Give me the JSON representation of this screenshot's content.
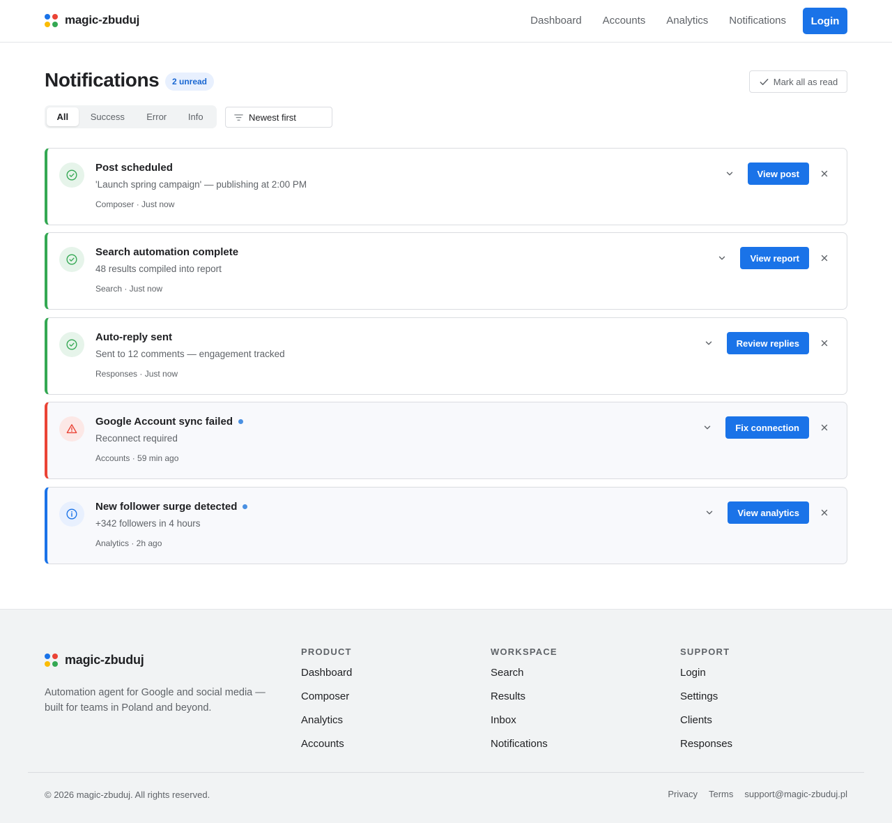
{
  "brand": {
    "name": "magic-zbuduj",
    "dot_colors": [
      "#1a73e8",
      "#ea4335",
      "#fbbc04",
      "#34a853"
    ]
  },
  "nav": {
    "items": [
      "Dashboard",
      "Accounts",
      "Analytics",
      "Notifications"
    ],
    "login": "Login"
  },
  "page": {
    "title": "Notifications",
    "unread_badge": "2 unread",
    "mark_all": "Mark all as read",
    "tabs": [
      "All",
      "Success",
      "Error",
      "Info"
    ],
    "active_tab": "All",
    "sort": "Newest first"
  },
  "notifications": [
    {
      "type": "success",
      "title": "Post scheduled",
      "description": "'Launch spring campaign' — publishing at 2:00 PM",
      "meta": "Composer · Just now",
      "action": "View post",
      "unread": false
    },
    {
      "type": "success",
      "title": "Search automation complete",
      "description": "48 results compiled into report",
      "meta": "Search · Just now",
      "action": "View report",
      "unread": false
    },
    {
      "type": "success",
      "title": "Auto-reply sent",
      "description": "Sent to 12 comments — engagement tracked",
      "meta": "Responses · Just now",
      "action": "Review replies",
      "unread": false
    },
    {
      "type": "error",
      "title": "Google Account sync failed",
      "description": "Reconnect required",
      "meta": "Accounts · 59 min ago",
      "action": "Fix connection",
      "unread": true
    },
    {
      "type": "info",
      "title": "New follower surge detected",
      "description": "+342 followers in 4 hours",
      "meta": "Analytics · 2h ago",
      "action": "View analytics",
      "unread": true
    }
  ],
  "type_colors": {
    "success": {
      "accent": "#34a853",
      "icon_bg": "#e6f4ea",
      "icon": "check-circle-icon"
    },
    "error": {
      "accent": "#ea4335",
      "icon_bg": "#fce8e6",
      "icon": "warning-triangle-icon"
    },
    "info": {
      "accent": "#1a73e8",
      "icon_bg": "#e8f0fe",
      "icon": "info-circle-icon"
    }
  },
  "footer": {
    "tagline": "Automation agent for Google and social media — built for teams in Poland and beyond.",
    "columns": [
      {
        "heading": "PRODUCT",
        "links": [
          "Dashboard",
          "Composer",
          "Analytics",
          "Accounts"
        ]
      },
      {
        "heading": "WORKSPACE",
        "links": [
          "Search",
          "Results",
          "Inbox",
          "Notifications"
        ]
      },
      {
        "heading": "SUPPORT",
        "links": [
          "Login",
          "Settings",
          "Clients",
          "Responses"
        ]
      }
    ],
    "copyright": "© 2026 magic-zbuduj. All rights reserved.",
    "legal": [
      "Privacy",
      "Terms",
      "support@magic-zbuduj.pl"
    ]
  }
}
